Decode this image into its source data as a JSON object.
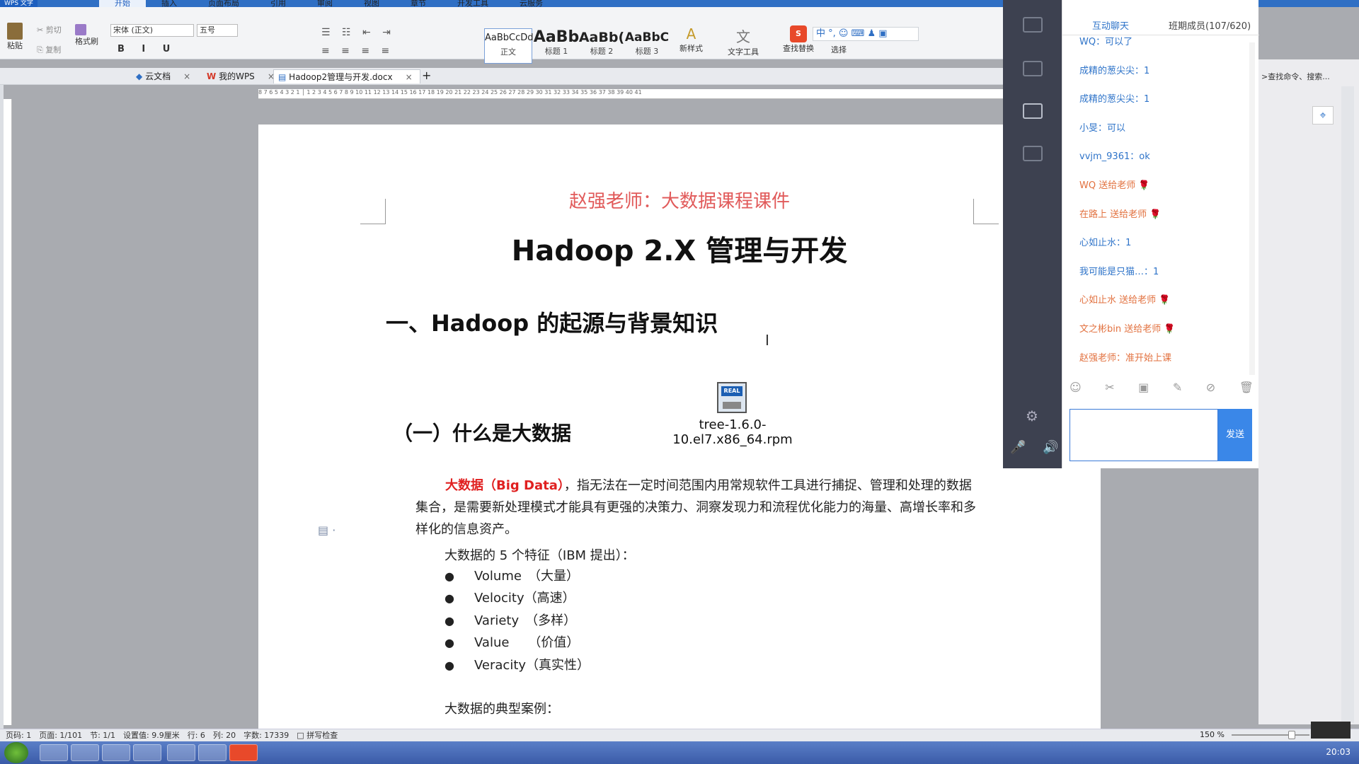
{
  "app": {
    "menu_label": "WPS 文字",
    "menu_tabs": [
      "开始",
      "插入",
      "页面布局",
      "引用",
      "审阅",
      "视图",
      "章节",
      "开发工具",
      "云服务"
    ],
    "active_tab_index": 0
  },
  "toolbar": {
    "paste": "粘贴",
    "cut": "剪切",
    "copy": "复制",
    "format_painter": "格式刷",
    "font_name": "宋体 (正文)",
    "font_size": "五号",
    "styles": [
      {
        "sample": "AaBbCcDd",
        "label": "正文"
      },
      {
        "sample": "AaBb",
        "label": "标题 1"
      },
      {
        "sample": "AaBb(",
        "label": "标题 2"
      },
      {
        "sample": "AaBbC",
        "label": "标题 3"
      }
    ],
    "new_style": "新样式",
    "text_tools": "文字工具",
    "find_replace": "查找替换",
    "select": "选择"
  },
  "tabs": [
    {
      "label": "云文档"
    },
    {
      "label": "我的WPS"
    },
    {
      "label": "Hadoop2管理与开发.docx"
    }
  ],
  "ruler": {
    "marks": "8 7 6 5 4 3 2 1 │ 1 2 3 4 5 6 7 8 9 10 11 12 13 14 15 16 17 18 19 20 21 22 23 24 25 26 27 28 29 30 31 32 33 34 35 36 37 38 39 40 41"
  },
  "document": {
    "subtitle": "赵强老师：大数据课程课件",
    "title": "Hadoop 2.X  管理与开发",
    "heading1": "一、Hadoop 的起源与背景知识",
    "heading2": "（一）什么是大数据",
    "attachment_badge": "REAL",
    "attachment_name": "tree-1.6.0-10.el7.x86_64.rpm",
    "para_highlight": "大数据（Big Data）",
    "para_rest": "，指无法在一定时间范围内用常规软件工具进行捕捉、管理和处理的数据集合，是需要新处理模式才能具有更强的决策力、洞察发现力和流程优化能力的海量、高增长率和多样化的信息资产。",
    "features_intro": "大数据的 5 个特征（IBM 提出）：",
    "features": [
      "Volume　（大量）",
      "Velocity（高速）",
      "Variety　（多样）",
      "Value　　（价值）",
      "Veracity（真实性）"
    ],
    "cases_heading": "大数据的典型案例："
  },
  "chat": {
    "tab_chat": "互动聊天",
    "tab_members": "班期成员(107/620)",
    "messages": [
      {
        "text": "WQ：可以了",
        "kind": "user"
      },
      {
        "text": "成精的葱尖尖：1",
        "kind": "user"
      },
      {
        "text": "成精的葱尖尖：1",
        "kind": "user"
      },
      {
        "text": "小旻：可以",
        "kind": "user"
      },
      {
        "text": "vvjm_9361：ok",
        "kind": "user"
      },
      {
        "text": "WQ 送给老师 🌹",
        "kind": "gift"
      },
      {
        "text": "在路上 送给老师 🌹",
        "kind": "gift"
      },
      {
        "text": "心如止水：1",
        "kind": "user"
      },
      {
        "text": "我可能是只猫…：1",
        "kind": "user"
      },
      {
        "text": "心如止水 送给老师 🌹",
        "kind": "gift"
      },
      {
        "text": "文之彬bin 送给老师 🌹",
        "kind": "gift"
      },
      {
        "text": "赵强老师：准开始上课",
        "kind": "gift"
      }
    ],
    "send_label": "发送"
  },
  "search_cmd": ">查找命令、搜索...",
  "status": {
    "text": "页码: 1　页面: 1/101　节: 1/1　设置值: 9.9厘米　行: 6　列: 20　字数: 17339　□ 拼写检查",
    "zoom": "150 %"
  },
  "taskbar": {
    "time": "20:03"
  },
  "colors": {
    "accent": "#2f6fc4",
    "doc_subtitle": "#e15a5a",
    "highlight_red": "#e02020",
    "send_button": "#3a87e8"
  }
}
